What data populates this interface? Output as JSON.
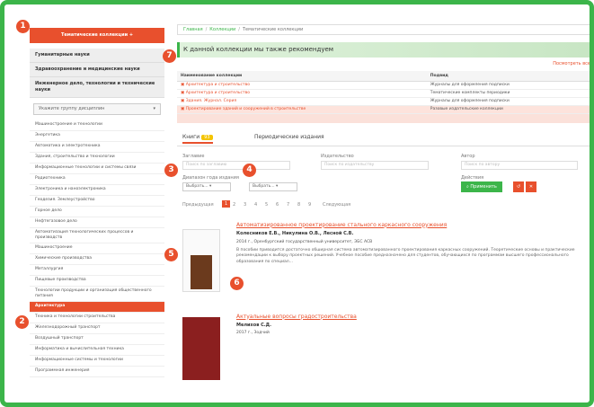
{
  "sidebar": {
    "top_button": "Тематические коллекции +",
    "sections": [
      "Гуманитарные науки",
      "Здравоохранение и медицинские науки",
      "Инженерное дело, технологии и технические науки"
    ],
    "select_label": "Укажите группу дисциплин",
    "items": [
      "Машиностроение и технологии",
      "Энергетика",
      "Автоматика и электротехника",
      "Здания, строительство и технологии",
      "Информационные технологии и системы связи",
      "Радиотехника",
      "Электроника и наноэлектроника",
      "Геодезия. Землеустройство",
      "Горное дело",
      "Нефтегазовое дело",
      "Автоматизация технологических процессов и производств",
      "Машиностроение",
      "Химические производства",
      "Металлургия",
      "Пищевые производства",
      "Технологии продукции и организация общественного питания",
      "Архитектура",
      "Техника и технологии строительства",
      "Железнодорожный транспорт",
      "Воздушный транспорт",
      "Информатика и вычислительная техника",
      "Информационные системы и технологии",
      "Программная инженерия"
    ],
    "active_index": 16
  },
  "breadcrumb": [
    "Главная",
    "Коллекции",
    "Тематические коллекции"
  ],
  "recommend": {
    "title": "К данной коллекции мы также рекомендуем",
    "all_link": "Посмотреть все",
    "col_collection": "Наименование коллекции",
    "col_type": "Подвид",
    "rows": [
      {
        "name": "Архитектура и строительство",
        "type": "Журналы для оформления подписки"
      },
      {
        "name": "Архитектура и строительство",
        "type": "Тематические комплекты периодики"
      },
      {
        "name": "Здания. Журнал. Серия",
        "type": "Журналы для оформления подписки"
      },
      {
        "name": "Проектирование зданий и сооружений в строительстве",
        "type": "Разовые издательские коллекции"
      }
    ]
  },
  "tabs": {
    "books": "Книги",
    "books_count": "93",
    "periodicals": "Периодические издания"
  },
  "filter": {
    "authors_label": "Заглавие",
    "authors_placeholder": "Поиск по заглавию",
    "publisher_label": "Издательство",
    "publisher_placeholder": "Поиск по издательству",
    "author_label": "Автор",
    "author_placeholder": "Поиск по автору",
    "year_label": "Диапазон года издания",
    "year_from": "Выбрать...",
    "year_to": "Выбрать...",
    "actions_label": "Действия",
    "search_btn": "Применить"
  },
  "pager": {
    "prev": "Предыдущая",
    "pages": [
      "1",
      "2",
      "3",
      "4",
      "5",
      "6",
      "7",
      "8",
      "9"
    ],
    "next": "Следующая"
  },
  "books": [
    {
      "title": "Автоматизированное проектирование стального каркасного сооружения",
      "authors": "Колесников Е.В., Никулина О.В., Лесной С.В.",
      "publisher": "2014 г., Оренбургский государственный университет, ЭБС АСВ",
      "description": "В пособии приводится достаточно обширная система автоматизированного проектирования каркасных сооружений. Теоретические основы и практические рекомендации к выбору проектных решений. Учебное пособие предназначено для студентов, обучающихся по программам высшего профессионального образования по специал..."
    },
    {
      "title": "Актуальные вопросы градостроительства",
      "authors": "Мелихов С.Д.",
      "publisher": "2017 г., Зодчий",
      "description": ""
    }
  ],
  "callouts": [
    "1",
    "2",
    "3",
    "4",
    "5",
    "6",
    "7"
  ],
  "colors": {
    "accent": "#e8502d",
    "green": "#3cb54a",
    "yellow": "#f4c400"
  }
}
